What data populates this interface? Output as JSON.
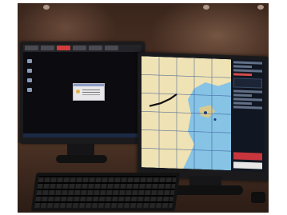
{
  "scene": {
    "subject": "two-monitor-workstation"
  },
  "left_monitor": {
    "toolbar_tabs": [
      "",
      "",
      "",
      "",
      "",
      ""
    ],
    "active_tab_index": 2,
    "toolbar_right_text": ""
  },
  "right_monitor": {
    "chart_colors": {
      "sea": "#86c3e4",
      "land": "#efe2b4",
      "grid": "#2a4a8f"
    }
  }
}
